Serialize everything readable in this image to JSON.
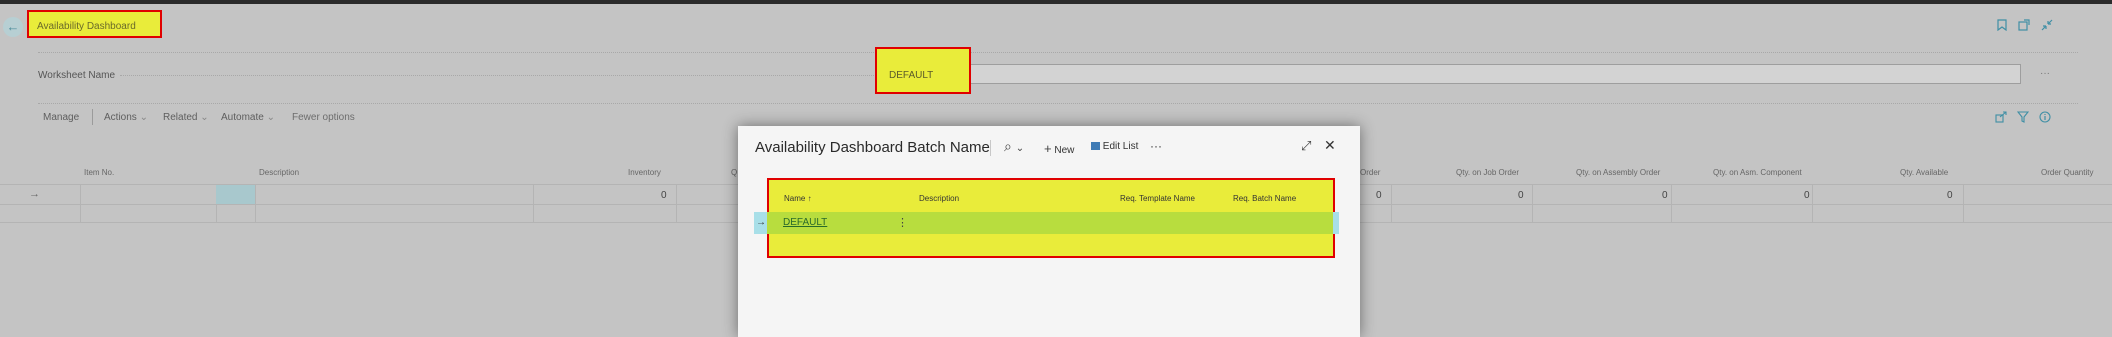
{
  "page": {
    "title": "Availability Dashboard",
    "field_label": "Worksheet Name",
    "field_value": "DEFAULT",
    "field_more": "···",
    "back_glyph": "←"
  },
  "header_icons": [
    "bookmark-icon",
    "share-window-icon",
    "collapse-icon"
  ],
  "commands": {
    "manage": "Manage",
    "actions": "Actions",
    "related": "Related",
    "automate": "Automate",
    "fewer_options": "Fewer options",
    "chevron": "⌄"
  },
  "right_icons": [
    "share-icon",
    "filter-icon",
    "info-icon"
  ],
  "grid": {
    "columns": [
      "Item No.",
      "Description",
      "Inventory",
      "Q",
      "Order",
      "Qty. on Job Order",
      "Qty. on Assembly Order",
      "Qty. on Asm. Component",
      "Qty. Available",
      "Order Quantity"
    ],
    "row": {
      "arrow": "→",
      "inventory": "0",
      "order": "0",
      "qty_job": "0",
      "qty_assembly": "0",
      "qty_asm_component": "0",
      "qty_available": "0"
    }
  },
  "dialog": {
    "title": "Availability Dashboard Batch Name",
    "search_glyph": "⌕",
    "new_label": "New",
    "edit_list_label": "Edit List",
    "more_glyph": "···",
    "expand_glyph": "⤢",
    "close_glyph": "✕",
    "list": {
      "headers": [
        "Name ↑",
        "Description",
        "Req. Template Name",
        "Req. Batch Name"
      ],
      "rows": [
        {
          "name": "DEFAULT",
          "description": "",
          "template": "",
          "batch": ""
        }
      ],
      "row_menu_glyph": "⋮",
      "row_arrow": "→"
    }
  }
}
